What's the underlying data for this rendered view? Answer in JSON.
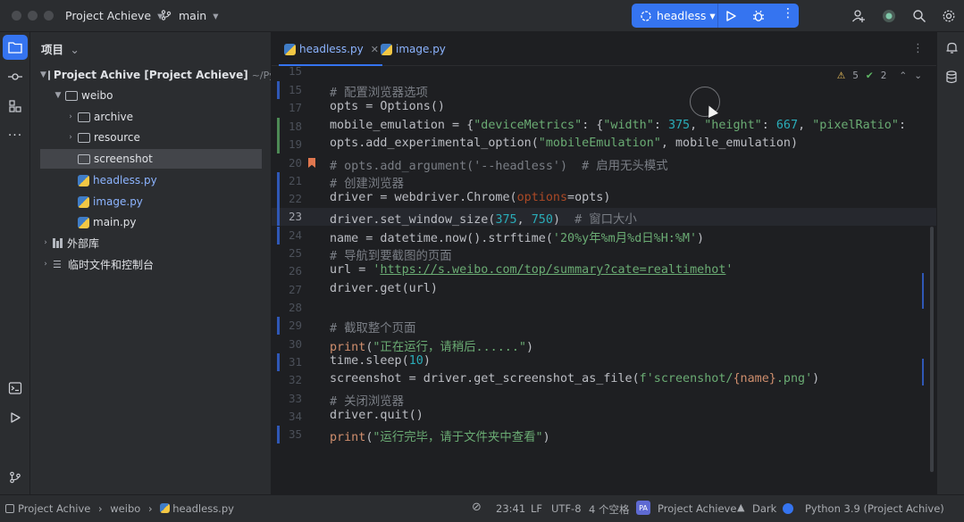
{
  "titlebar": {
    "project_name": "Project Achieve",
    "branch": "main",
    "run_config": "headless",
    "chevron": "▾"
  },
  "project_panel": {
    "header": "项目",
    "items": [
      {
        "label": "Project Achive [Project Achieve]",
        "suffix": "~/Pycharm",
        "type": "folder",
        "expanded": true
      },
      {
        "label": "weibo",
        "type": "folder",
        "expanded": true
      },
      {
        "label": "archive",
        "type": "folder",
        "expanded": false
      },
      {
        "label": "resource",
        "type": "folder",
        "expanded": false
      },
      {
        "label": "screenshot",
        "type": "folder",
        "selected": true
      },
      {
        "label": "headless.py",
        "type": "python"
      },
      {
        "label": "image.py",
        "type": "python"
      },
      {
        "label": "main.py",
        "type": "python"
      },
      {
        "label": "外部库",
        "type": "library"
      },
      {
        "label": "临时文件和控制台",
        "type": "scratch"
      }
    ]
  },
  "editor": {
    "tabs": [
      {
        "label": "headless.py",
        "active": true
      },
      {
        "label": "image.py",
        "active": false
      }
    ],
    "inspections": {
      "warnings": "5",
      "ok": "2"
    },
    "line_numbers": [
      "15",
      "17",
      "18",
      "19",
      "20",
      "21",
      "22",
      "23",
      "24",
      "25",
      "26",
      "27",
      "28",
      "29",
      "30",
      "31",
      "32",
      "33",
      "34",
      "35"
    ],
    "current_line": "23"
  },
  "code_strings": {
    "l15": "# 配置浏览器选项",
    "l18_str1": "\"deviceMetrics\"",
    "l18_str2": "\"width\"",
    "l18_num1": "375",
    "l18_str3": "\"height\"",
    "l18_num2": "667",
    "l18_str4": "\"pixelRatio\"",
    "l19_str": "\"mobileEmulation\"",
    "l20": "# opts.add_argument('--headless')  # 启用无头模式",
    "l21": "# 创建浏览器",
    "l23_num1": "375",
    "l23_num2": "750",
    "l23_com": "# 窗口大小",
    "l24_fmt": "'20%y年%m月%d日%H:%M'",
    "l25": "# 导航到要截图的页面",
    "l26_url": "https://s.weibo.com/top/summary?cate=realtimehot",
    "l29": "# 截取整个页面",
    "l30_str": "\"正在运行，请稍后......\"",
    "l31_num": "10",
    "l32_str1": "f'screenshot/",
    "l32_str2": "{name}",
    "l32_str3": ".png'",
    "l33": "# 关闭浏览器",
    "l35_str": "\"运行完毕，请于文件夹中查看\""
  },
  "status_bar": {
    "breadcrumb": [
      "Project Achive",
      "weibo",
      "headless.py"
    ],
    "position": "23:41",
    "line_sep": "LF",
    "encoding": "UTF-8",
    "indent": "4 个空格",
    "project": "Project Achieve",
    "theme": "Dark",
    "interpreter": "Python 3.9 (Project Achive)"
  },
  "colors": {
    "accent": "#3574f0",
    "background": "#1e1f22",
    "panel": "#2b2d30",
    "string": "#6aab73",
    "keyword": "#cf8e6d",
    "number": "#2aacb8",
    "comment": "#7a7e85"
  }
}
